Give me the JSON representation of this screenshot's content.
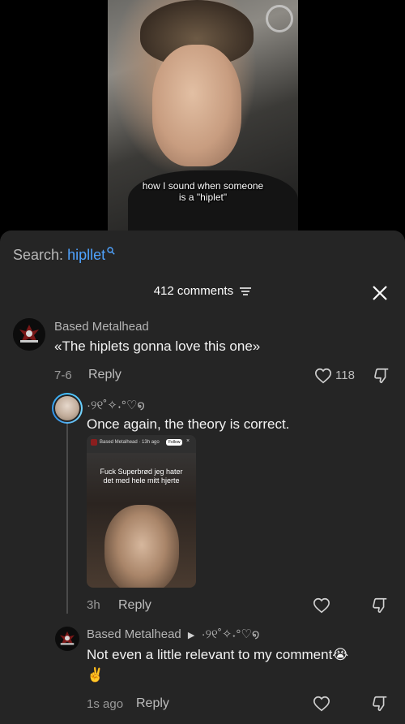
{
  "video": {
    "caption_line1": "how I sound when someone",
    "caption_line2": "is a \"hiplet\""
  },
  "search": {
    "prefix": "Search:",
    "term": "hipllet",
    "icon": "search-icon"
  },
  "header": {
    "comment_count": "412 comments",
    "sort_icon": "sort-lines-icon",
    "close_icon": "close-icon"
  },
  "comments": [
    {
      "author": "Based Metalhead",
      "text": "«The hiplets gonna love this one»",
      "date": "7-6",
      "reply_label": "Reply",
      "likes": "118"
    },
    {
      "author": "·୨୧˚✧˖°♡໑",
      "text": "Once again, the theory is correct.",
      "attached_image": {
        "author": "Based Metalhead · 13h ago",
        "follow": "Follow",
        "close": "×",
        "caption_line1": "Fuck Superbrød jeg hater",
        "caption_line2": "det med hele mitt hjerte"
      },
      "date": "3h",
      "reply_label": "Reply"
    },
    {
      "author": "Based Metalhead",
      "reply_to": "·୨୧˚✧˖°♡໑",
      "text": "Not even a little relevant to my comment😭",
      "emoji_line": "✌️",
      "date": "1s ago",
      "reply_label": "Reply"
    }
  ],
  "colors": {
    "sheet_bg": "#252525",
    "search_term": "#4fa3ff",
    "story_ring": "#46c2ff"
  }
}
